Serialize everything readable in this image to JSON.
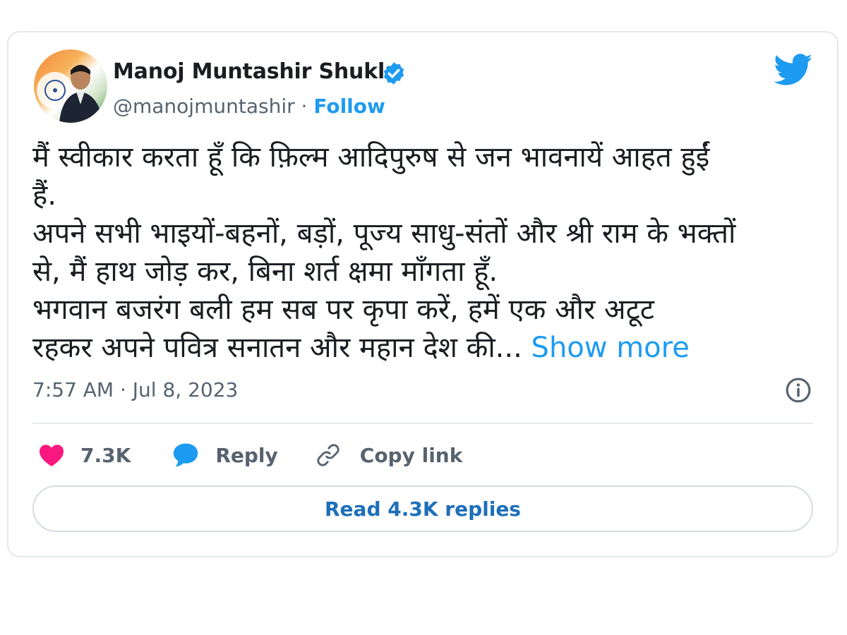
{
  "author": {
    "name": "Manoj Muntashir Shukla",
    "handle": "@manojmuntashir",
    "separator": "·",
    "follow_label": "Follow"
  },
  "tweet": {
    "lines": [
      "मैं स्वीकार करता हूँ कि फ़िल्म आदिपुरुष से जन भावनायें आहत हुईं",
      "हैं.",
      "अपने सभी भाइयों-बहनों, बड़ों, पूज्य साधु-संतों और श्री राम के भक्तों",
      "से, मैं हाथ जोड़ कर, बिना शर्त क्षमा माँगता हूँ.",
      "भगवान बजरंग बली हम सब पर कृपा करें, हमें एक और अटूट",
      "रहकर अपने पवित्र सनातन और महान देश की..."
    ],
    "show_more": "Show more",
    "timestamp": "7:57 AM · Jul 8, 2023"
  },
  "actions": {
    "likes": "7.3K",
    "reply_label": "Reply",
    "copy_link_label": "Copy link"
  },
  "read_replies_label": "Read 4.3K replies",
  "colors": {
    "accent": "#1d9bf0",
    "like": "#f91880",
    "text": "#1a1d21",
    "muted": "#56636f"
  },
  "icons": [
    "avatar",
    "verified-badge-icon",
    "twitter-bird-icon",
    "info-icon",
    "heart-icon",
    "reply-bubble-icon",
    "link-icon"
  ]
}
